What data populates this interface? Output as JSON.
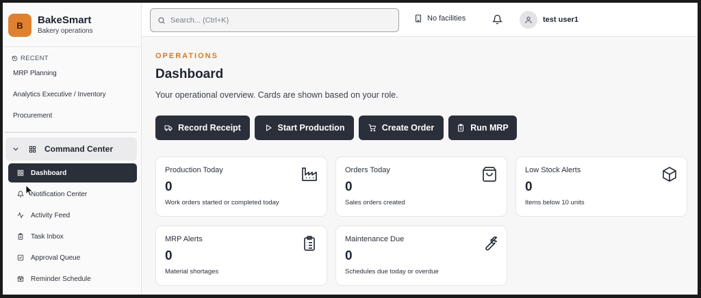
{
  "brand": {
    "logo_letter": "B",
    "name": "BakeSmart",
    "subtitle": "Bakery operations",
    "logo_color": "#e0812f"
  },
  "sidebar": {
    "recent_heading": "RECENT",
    "recent_items": [
      "MRP Planning",
      "Analytics Executive / Inventory",
      "Procurement"
    ],
    "section": {
      "label": "Command Center",
      "icon": "grid-icon"
    },
    "nav_items": [
      {
        "label": "Dashboard",
        "icon": "grid-icon",
        "active": true
      },
      {
        "label": "Notification Center",
        "icon": "bell-icon",
        "active": false
      },
      {
        "label": "Activity Feed",
        "icon": "activity-icon",
        "active": false
      },
      {
        "label": "Task Inbox",
        "icon": "clipboard-icon",
        "active": false
      },
      {
        "label": "Approval Queue",
        "icon": "check-square-icon",
        "active": false
      },
      {
        "label": "Reminder Schedule",
        "icon": "calendar-icon",
        "active": false
      }
    ]
  },
  "topbar": {
    "search_placeholder": "Search... (Ctrl+K)",
    "facilities": "No facilities",
    "user_name": "test user1"
  },
  "main": {
    "eyebrow": "OPERATIONS",
    "title": "Dashboard",
    "subtitle": "Your operational overview. Cards are shown based on your role.",
    "accent_color": "#d17a22",
    "actions": [
      {
        "label": "Record Receipt",
        "icon": "truck-icon"
      },
      {
        "label": "Start Production",
        "icon": "play-icon"
      },
      {
        "label": "Create Order",
        "icon": "cart-icon"
      },
      {
        "label": "Run MRP",
        "icon": "clipboard-icon"
      }
    ],
    "cards": [
      {
        "title": "Production Today",
        "value": "0",
        "desc": "Work orders started or completed today",
        "icon": "factory-icon"
      },
      {
        "title": "Orders Today",
        "value": "0",
        "desc": "Sales orders created",
        "icon": "shopping-bag-icon"
      },
      {
        "title": "Low Stock Alerts",
        "value": "0",
        "desc": "Items below 10 units",
        "icon": "package-icon"
      },
      {
        "title": "MRP Alerts",
        "value": "0",
        "desc": "Material shortages",
        "icon": "clipboard-list-icon"
      },
      {
        "title": "Maintenance Due",
        "value": "0",
        "desc": "Schedules due today or overdue",
        "icon": "wrench-icon"
      }
    ]
  }
}
